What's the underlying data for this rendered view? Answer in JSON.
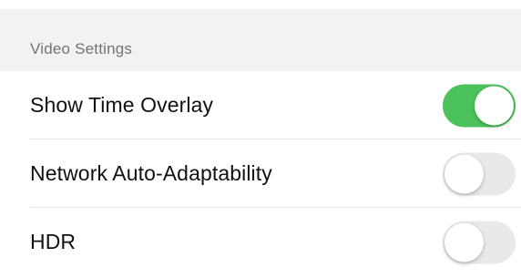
{
  "section": {
    "header": "Video Settings"
  },
  "settings": [
    {
      "label": "Show Time Overlay",
      "enabled": true
    },
    {
      "label": "Network Auto-Adaptability",
      "enabled": false
    },
    {
      "label": "HDR",
      "enabled": false
    }
  ],
  "colors": {
    "toggle_on": "#4bc25c",
    "toggle_off": "#e9e9eb",
    "header_background": "#f2f2f4"
  }
}
